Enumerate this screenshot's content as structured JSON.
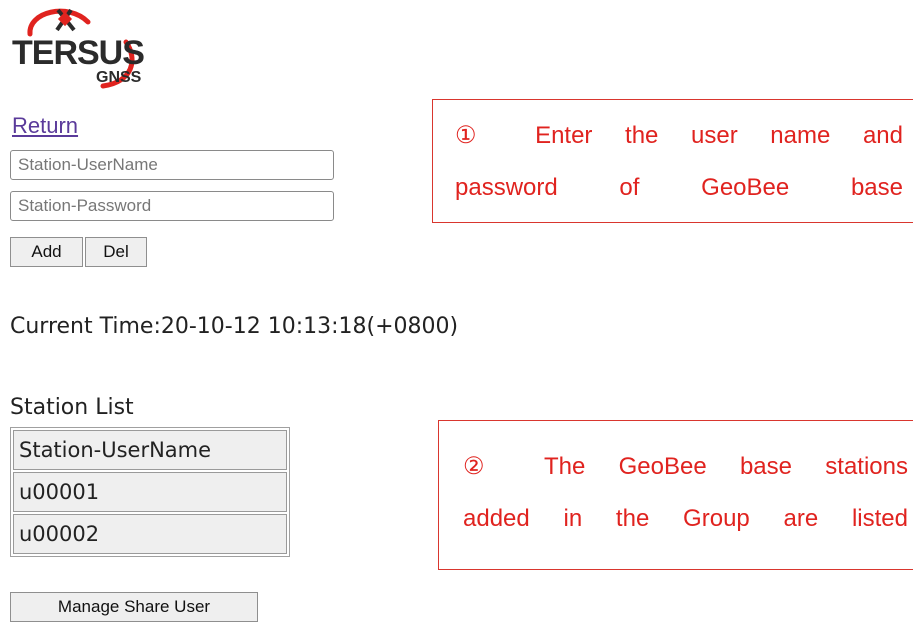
{
  "logo": {
    "name": "TERSUS",
    "sub": "GNSS",
    "brand_color": "#e0231f",
    "dark_color": "#2b2b2b"
  },
  "nav": {
    "return_label": "Return"
  },
  "form": {
    "username_placeholder": "Station-UserName",
    "password_placeholder": "Station-Password",
    "add_label": "Add",
    "del_label": "Del"
  },
  "status": {
    "current_time": "Current Time:20-10-12 10:13:18(+0800)"
  },
  "station_list": {
    "title": "Station List",
    "header": "Station-UserName",
    "rows": [
      "u00001",
      "u00002"
    ],
    "manage_label": "Manage Share User"
  },
  "annotations": {
    "callout_1": [
      "① Enter the user name and",
      "password of GeoBee base"
    ],
    "callout_2": [
      "② The GeoBee base stations",
      "added in the Group are listed"
    ],
    "color": "#e0231f"
  }
}
